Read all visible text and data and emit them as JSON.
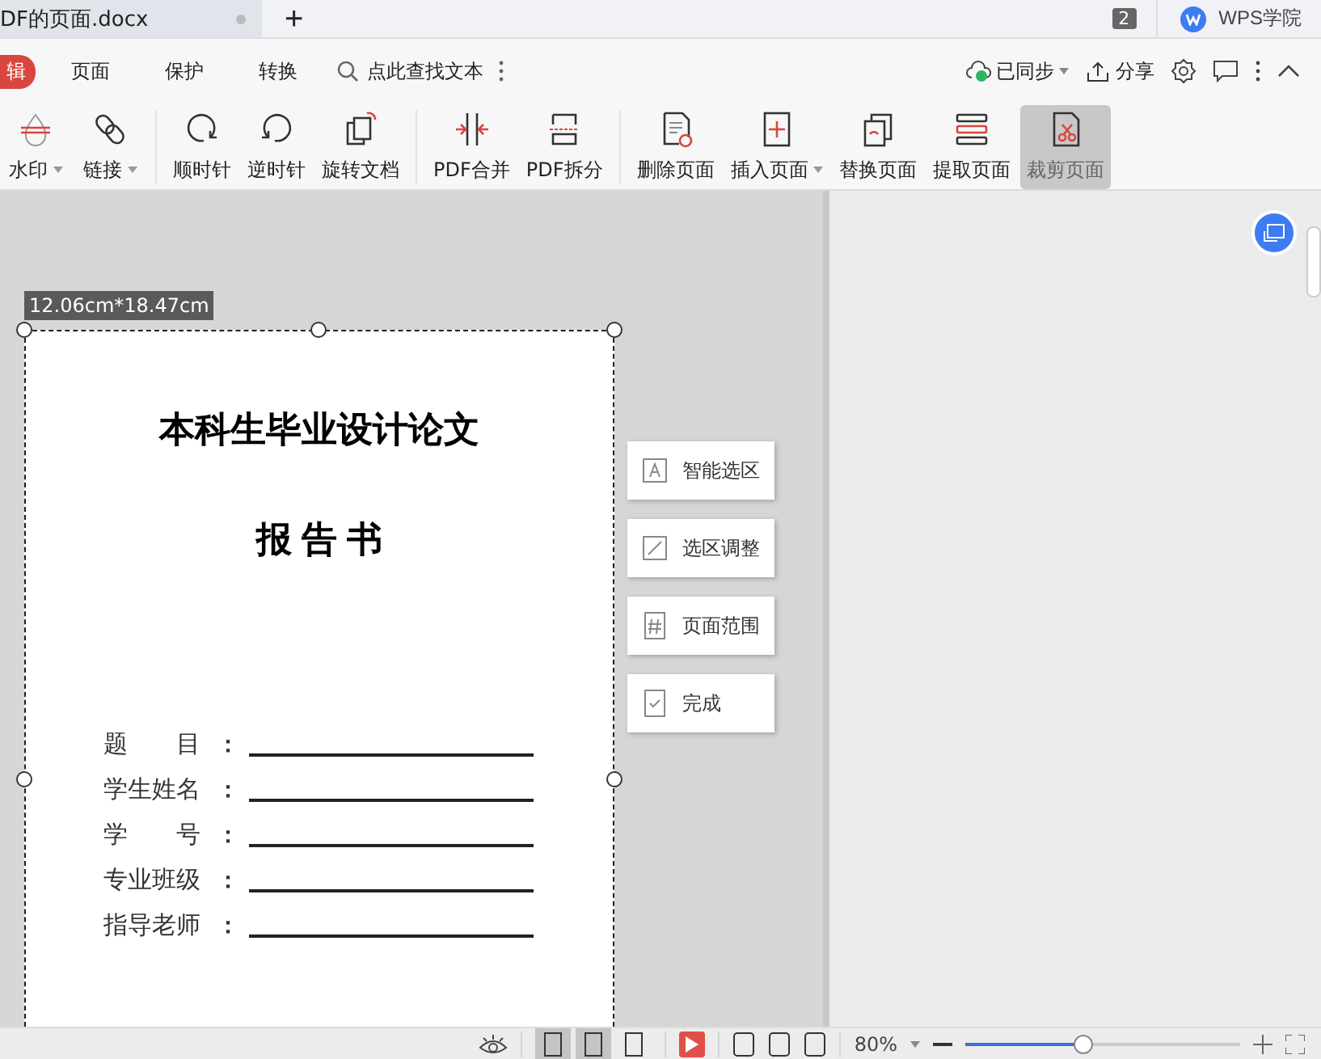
{
  "tabbar": {
    "doc_tab": "DF的页面.docx",
    "new_tab": "+",
    "badge": "2",
    "app_tab": "WPS学院"
  },
  "menu": {
    "edit_pill": "辑",
    "tabs": [
      "页面",
      "保护",
      "转换"
    ],
    "search": {
      "placeholder": "点此查找文本"
    },
    "sync": "已同步",
    "share": "分享"
  },
  "toolbar_groups": [
    [
      {
        "label": "水印",
        "dropdown": true,
        "selected": false
      },
      {
        "label": "链接",
        "dropdown": true,
        "selected": false
      }
    ],
    [
      {
        "label": "顺时针",
        "dropdown": false,
        "selected": false
      },
      {
        "label": "逆时针",
        "dropdown": false,
        "selected": false
      },
      {
        "label": "旋转文档",
        "dropdown": false,
        "selected": false
      }
    ],
    [
      {
        "label": "PDF合并",
        "dropdown": false,
        "selected": false
      },
      {
        "label": "PDF拆分",
        "dropdown": false,
        "selected": false
      }
    ],
    [
      {
        "label": "删除页面",
        "dropdown": false,
        "selected": false
      },
      {
        "label": "插入页面",
        "dropdown": true,
        "selected": false
      },
      {
        "label": "替换页面",
        "dropdown": false,
        "selected": false
      },
      {
        "label": "提取页面",
        "dropdown": false,
        "selected": false
      },
      {
        "label": "裁剪页面",
        "dropdown": false,
        "selected": true
      }
    ]
  ],
  "crop": {
    "size_label": "12.06cm*18.47cm",
    "actions": [
      "智能选区",
      "选区调整",
      "页面范围",
      "完成"
    ]
  },
  "page": {
    "title": "本科生毕业设计论文",
    "subtitle": "报 告 书",
    "fields": [
      {
        "label": "题　　目",
        "colon": "："
      },
      {
        "label": "学生姓名",
        "colon": "："
      },
      {
        "label": "学　　号",
        "colon": "："
      },
      {
        "label": "专业班级",
        "colon": "："
      },
      {
        "label": "指导老师",
        "colon": "："
      }
    ]
  },
  "status_bar": {
    "views": [
      {
        "selected": true
      },
      {
        "selected": true
      },
      {
        "selected": false
      }
    ],
    "zoom": "80%",
    "zoom_slider": {
      "level": 0.43
    }
  }
}
